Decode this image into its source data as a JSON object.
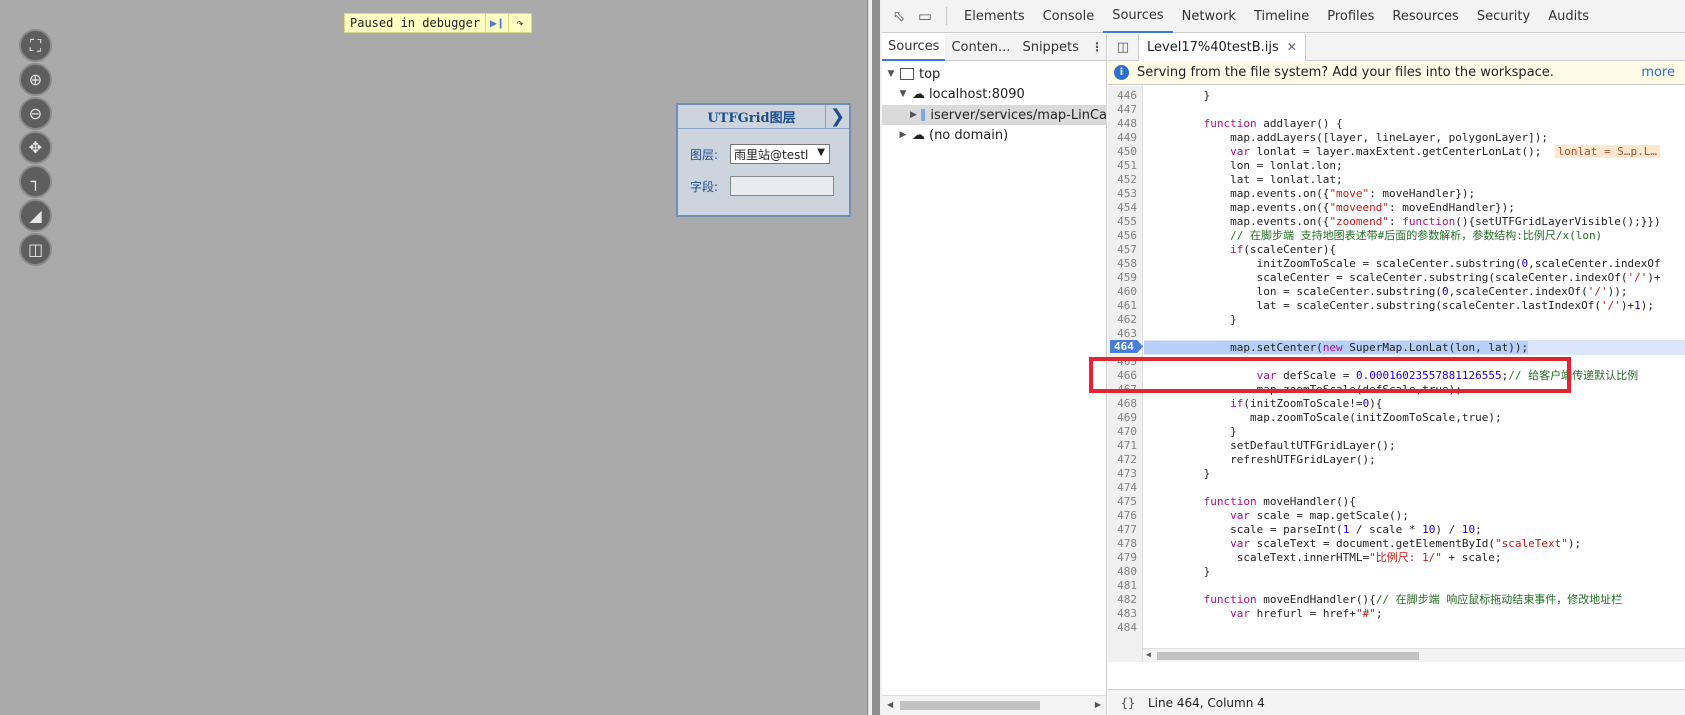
{
  "map_panel": {
    "pause_label": "Paused in debugger",
    "resume_icon": "resume-icon",
    "step_over_icon": "step-over-icon",
    "tools": [
      "full-extent-icon",
      "zoom-in-icon",
      "zoom-out-icon",
      "pan-icon",
      "measure-distance-icon",
      "measure-area-icon",
      "clear-icon"
    ],
    "utfgrid": {
      "title": "UTFGrid图层",
      "layer_label": "图层:",
      "layer_value": "雨里站@testl",
      "field_label": "字段:",
      "field_value": ""
    }
  },
  "devtools": {
    "tabs": [
      "Elements",
      "Console",
      "Sources",
      "Network",
      "Timeline",
      "Profiles",
      "Resources",
      "Security",
      "Audits"
    ],
    "active_tab": "Sources",
    "navigator_tabs": [
      "Sources",
      "Conten...",
      "Snippets"
    ],
    "tree": [
      {
        "label": "top",
        "icon": "frame-icon"
      },
      {
        "label": "localhost:8090",
        "icon": "cloud-icon"
      },
      {
        "label": "iserver/services/map-LinCa",
        "icon": "folder-icon"
      },
      {
        "label": "(no domain)",
        "icon": "cloud-icon"
      }
    ],
    "file_tab": "Level17%40testB.ijs",
    "info_message": "Serving from the file system? Add your files into the workspace.",
    "info_link": "more",
    "status": "Line 464, Column 4",
    "pretty_print": "{}",
    "code_lines": [
      {
        "n": "446",
        "t": "        }"
      },
      {
        "n": "447",
        "t": ""
      },
      {
        "n": "448",
        "t": "        function addlayer() {"
      },
      {
        "n": "449",
        "t": "            map.addLayers([layer, lineLayer, polygonLayer]);"
      },
      {
        "n": "450",
        "t": "            var lonlat = layer.maxExtent.getCenterLonLat();",
        "inline": "lonlat = S…p.L…"
      },
      {
        "n": "451",
        "t": "            lon = lonlat.lon;"
      },
      {
        "n": "452",
        "t": "            lat = lonlat.lat;"
      },
      {
        "n": "453",
        "t": "            map.events.on({\"move\": moveHandler});"
      },
      {
        "n": "454",
        "t": "            map.events.on({\"moveend\": moveEndHandler});"
      },
      {
        "n": "455",
        "t": "            map.events.on({\"zoomend\": function(){setUTFGridLayerVisible();}})"
      },
      {
        "n": "456",
        "t": "            // 在脚步端 支持地图表述带#后面的参数解析，参数结构:比例尺/x(lon)"
      },
      {
        "n": "457",
        "t": "            if(scaleCenter){"
      },
      {
        "n": "458",
        "t": "                initZoomToScale = scaleCenter.substring(0,scaleCenter.indexOf"
      },
      {
        "n": "459",
        "t": "                scaleCenter = scaleCenter.substring(scaleCenter.indexOf('/')+"
      },
      {
        "n": "460",
        "t": "                lon = scaleCenter.substring(0,scaleCenter.indexOf('/'));"
      },
      {
        "n": "461",
        "t": "                lat = scaleCenter.substring(scaleCenter.lastIndexOf('/')+1);"
      },
      {
        "n": "462",
        "t": "            }"
      },
      {
        "n": "463",
        "t": ""
      },
      {
        "n": "464",
        "t": "            map.setCenter(new SuperMap.LonLat(lon, lat));"
      },
      {
        "n": "465",
        "t": ""
      },
      {
        "n": "466",
        "t": "                var defScale = 0.00016023557881126555;// 给客户端传递默认比例"
      },
      {
        "n": "467",
        "t": "                map.zoomToScale(defScale,true);"
      },
      {
        "n": "468",
        "t": "            if(initZoomToScale!=0){"
      },
      {
        "n": "469",
        "t": "               map.zoomToScale(initZoomToScale,true);"
      },
      {
        "n": "470",
        "t": "            }"
      },
      {
        "n": "471",
        "t": "            setDefaultUTFGridLayer();"
      },
      {
        "n": "472",
        "t": "            refreshUTFGridLayer();"
      },
      {
        "n": "473",
        "t": "        }"
      },
      {
        "n": "474",
        "t": ""
      },
      {
        "n": "475",
        "t": "        function moveHandler(){"
      },
      {
        "n": "476",
        "t": "            var scale = map.getScale();"
      },
      {
        "n": "477",
        "t": "            scale = parseInt(1 / scale * 10) / 10;"
      },
      {
        "n": "478",
        "t": "            var scaleText = document.getElementById(\"scaleText\");"
      },
      {
        "n": "479",
        "t": "             scaleText.innerHTML=\"比例尺: 1/\" + scale;"
      },
      {
        "n": "480",
        "t": "        }"
      },
      {
        "n": "481",
        "t": ""
      },
      {
        "n": "482",
        "t": "        function moveEndHandler(){// 在脚步端 响应鼠标拖动结束事件，修改地址栏"
      },
      {
        "n": "483",
        "t": "            var hrefurl = href+\"#\";"
      },
      {
        "n": "484",
        "t": ""
      }
    ],
    "current_line": "464"
  }
}
